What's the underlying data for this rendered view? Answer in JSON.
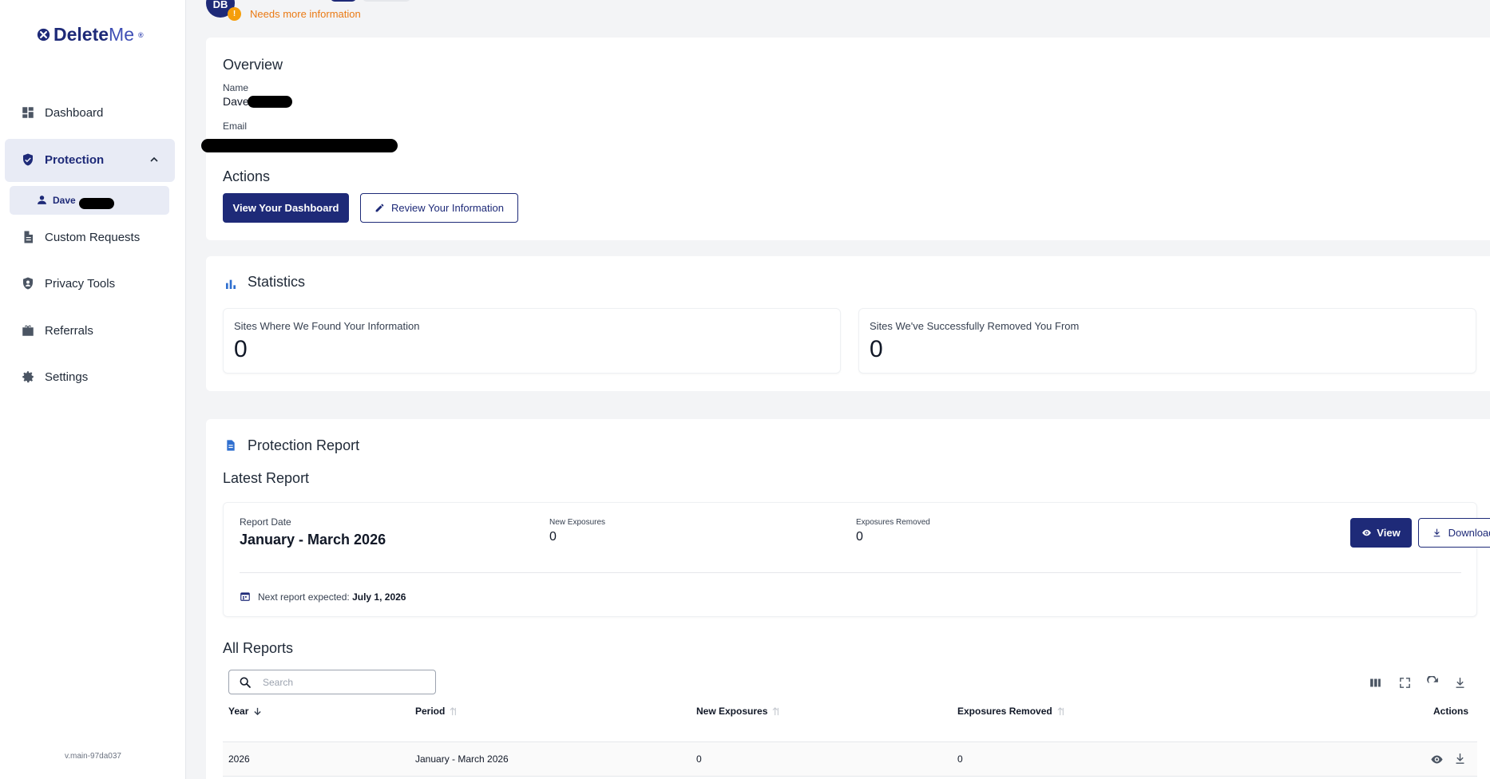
{
  "brand": {
    "name_bold": "Delete",
    "name_light": "Me",
    "mark": "®"
  },
  "nav": {
    "dashboard": "Dashboard",
    "protection": "Protection",
    "sub_member": "Dave",
    "custom_requests": "Custom Requests",
    "privacy_tools": "Privacy Tools",
    "referrals": "Referrals",
    "settings": "Settings"
  },
  "version": "v.main-97da037",
  "header": {
    "avatar_initials": "DB",
    "status": "Needs more information"
  },
  "overview": {
    "title": "Overview",
    "name_label": "Name",
    "name_value": "Dave",
    "email_label": "Email",
    "actions_title": "Actions",
    "view_dashboard": "View Your Dashboard",
    "review_info": "Review Your Information"
  },
  "statistics": {
    "title": "Statistics",
    "found_label": "Sites Where We Found Your Information",
    "found_value": "0",
    "removed_label": "Sites We've Successfully Removed You From",
    "removed_value": "0"
  },
  "report": {
    "title": "Protection Report",
    "latest_title": "Latest Report",
    "date_label": "Report Date",
    "date_value": "January - March 2026",
    "new_exposures_label": "New Exposures",
    "new_exposures_value": "0",
    "exposures_removed_label": "Exposures Removed",
    "exposures_removed_value": "0",
    "view_button": "View",
    "download_button": "Download",
    "next_prefix": "Next report expected:",
    "next_date": "July 1, 2026",
    "all_title": "All Reports",
    "search_placeholder": "Search",
    "columns": {
      "year": "Year",
      "period": "Period",
      "new_exposures": "New Exposures",
      "exposures_removed": "Exposures Removed",
      "actions": "Actions"
    },
    "rows": [
      {
        "year": "2026",
        "period": "January - March 2026",
        "new_exposures": "0",
        "exposures_removed": "0"
      }
    ]
  },
  "colors": {
    "brand": "#1e2a78",
    "warning": "#ea7a14",
    "accent_icon": "#2f6fcf"
  }
}
